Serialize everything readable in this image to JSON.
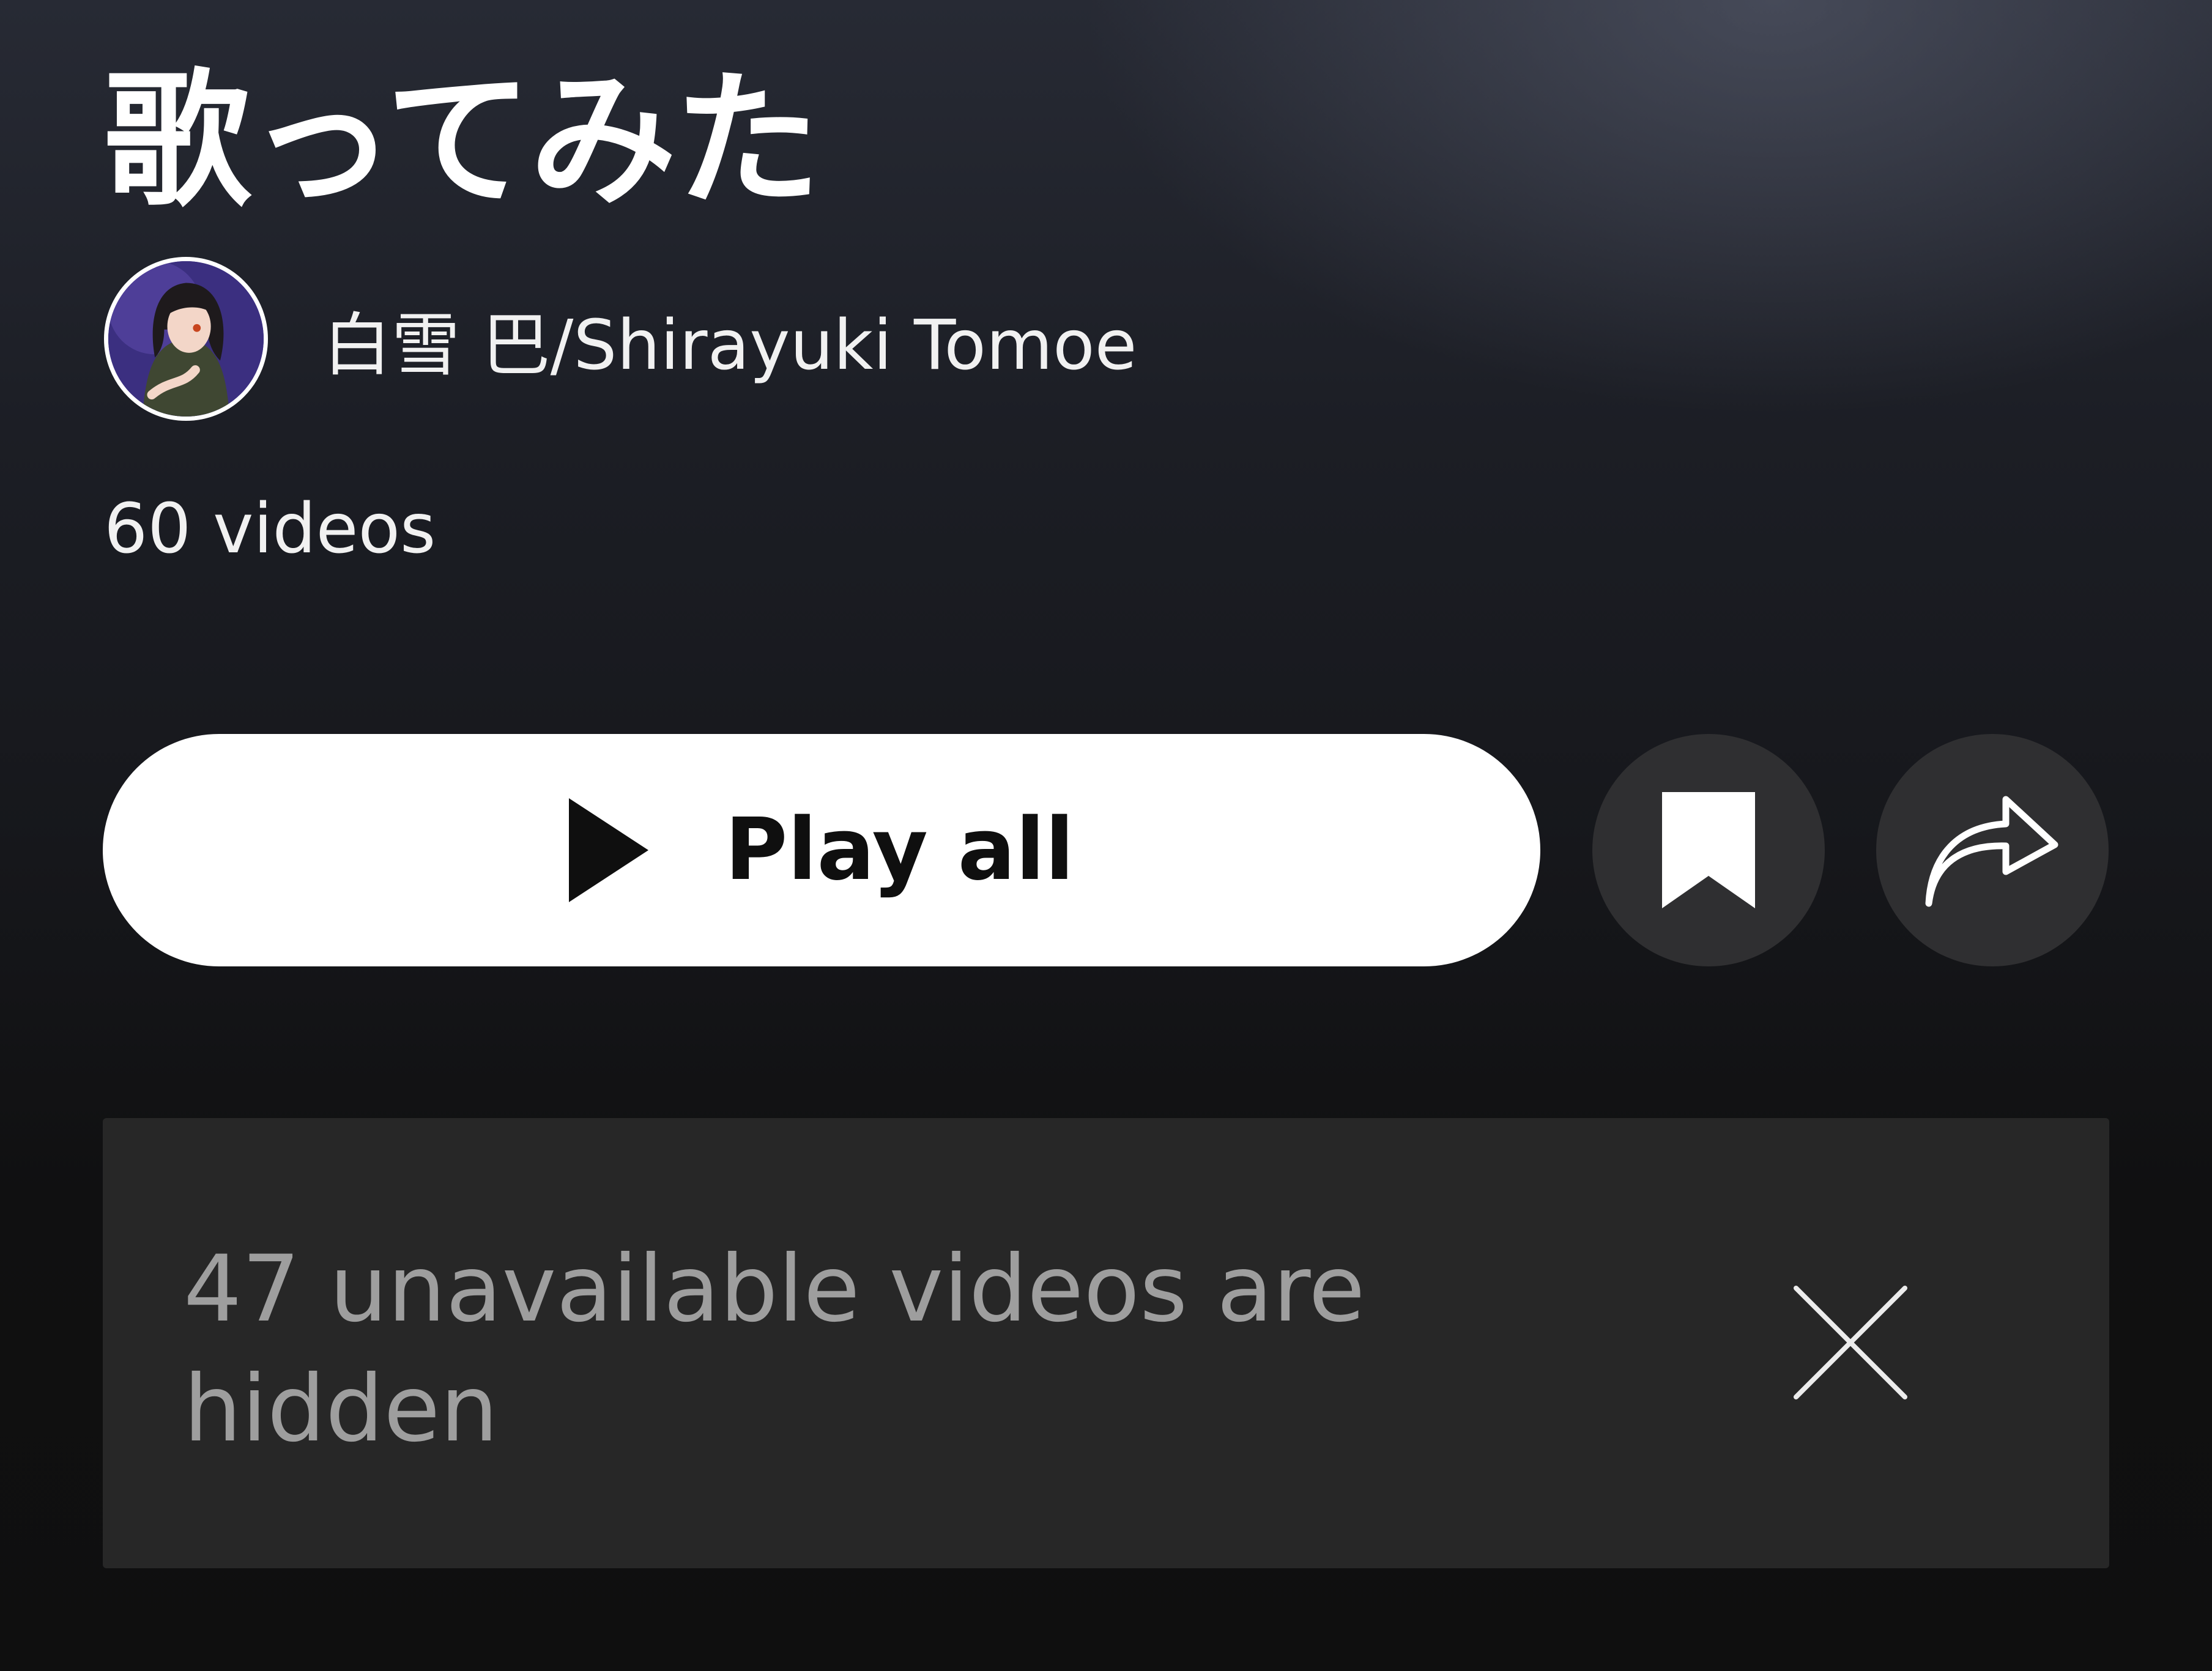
{
  "playlist": {
    "title": "歌ってみた",
    "channel_name": "白雪 巴/Shirayuki Tomoe",
    "video_count": "60 videos"
  },
  "actions": {
    "play_all_label": "Play all",
    "play_icon": "play-icon",
    "save_icon": "bookmark-icon",
    "share_icon": "share-arrow-icon"
  },
  "notice": {
    "text": "47 unavailable videos are hidden",
    "close_icon": "close-icon"
  },
  "colors": {
    "background_top": "#272a34",
    "background_bottom": "#0f0f0f",
    "primary_button": "#ffffff",
    "icon_button": "#2f2f31",
    "banner": "#272727",
    "banner_text": "#9e9e9e"
  }
}
